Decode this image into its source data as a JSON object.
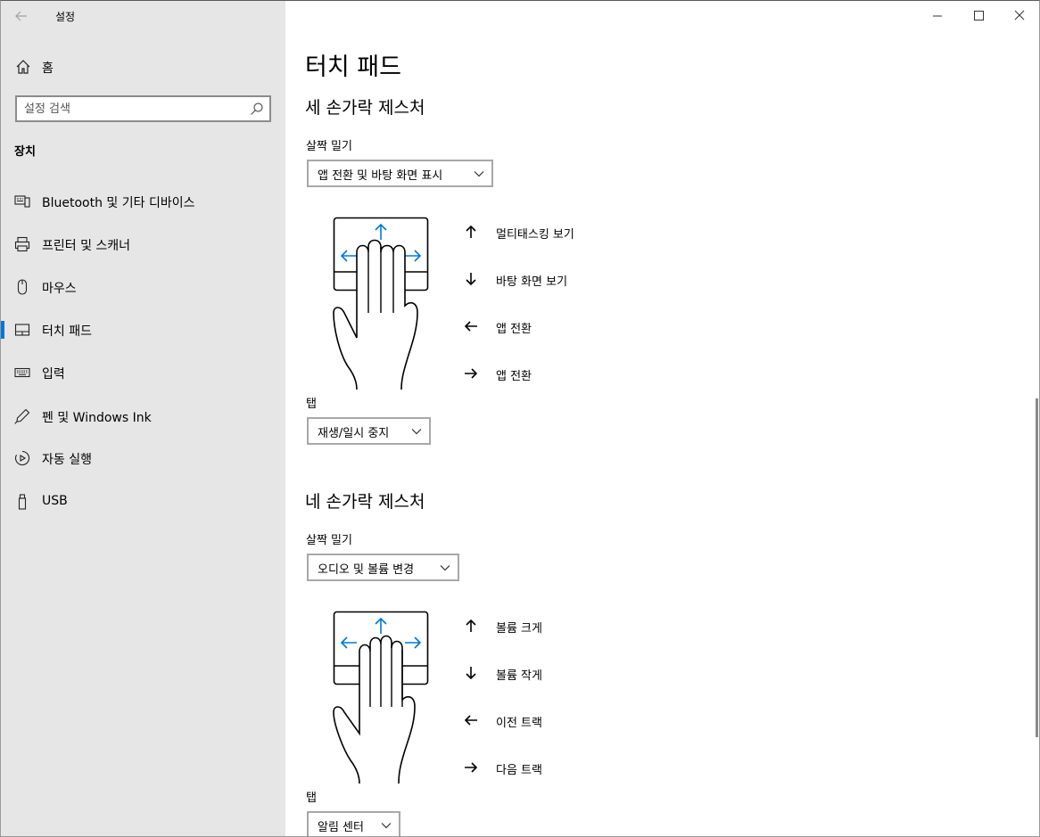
{
  "app": {
    "title": "설정",
    "back_icon": "back-arrow-icon"
  },
  "sidebar": {
    "home_label": "홈",
    "search_placeholder": "설정 검색",
    "section_label": "장치",
    "items": [
      {
        "label": "Bluetooth 및 기타 디바이스",
        "icon": "bluetooth-devices-icon",
        "active": false
      },
      {
        "label": "프린터 및 스캐너",
        "icon": "printer-icon",
        "active": false
      },
      {
        "label": "마우스",
        "icon": "mouse-icon",
        "active": false
      },
      {
        "label": "터치 패드",
        "icon": "touchpad-icon",
        "active": true
      },
      {
        "label": "입력",
        "icon": "keyboard-icon",
        "active": false
      },
      {
        "label": "펜 및 Windows Ink",
        "icon": "pen-icon",
        "active": false
      },
      {
        "label": "자동 실행",
        "icon": "autoplay-icon",
        "active": false
      },
      {
        "label": "USB",
        "icon": "usb-icon",
        "active": false
      }
    ]
  },
  "main": {
    "page_title": "터치 패드",
    "three_finger": {
      "heading": "세 손가락 제스처",
      "swipe_label": "살짝 밀기",
      "swipe_value": "앱 전환 및 바탕 화면 표시",
      "gestures": [
        {
          "arrow": "up",
          "text": "멀티태스킹 보기"
        },
        {
          "arrow": "down",
          "text": "바탕 화면 보기"
        },
        {
          "arrow": "left",
          "text": "앱 전환"
        },
        {
          "arrow": "right",
          "text": "앱 전환"
        }
      ],
      "tap_label": "탭",
      "tap_value": "재생/일시 중지"
    },
    "four_finger": {
      "heading": "네 손가락 제스처",
      "swipe_label": "살짝 밀기",
      "swipe_value": "오디오 및 볼륨 변경",
      "gestures": [
        {
          "arrow": "up",
          "text": "볼륨 크게"
        },
        {
          "arrow": "down",
          "text": "볼륨 작게"
        },
        {
          "arrow": "left",
          "text": "이전 트랙"
        },
        {
          "arrow": "right",
          "text": "다음 트랙"
        }
      ],
      "tap_label": "탭",
      "tap_value": "알림 센터"
    }
  },
  "colors": {
    "accent": "#0078d7",
    "sidebar_bg": "#e6e6e6"
  }
}
